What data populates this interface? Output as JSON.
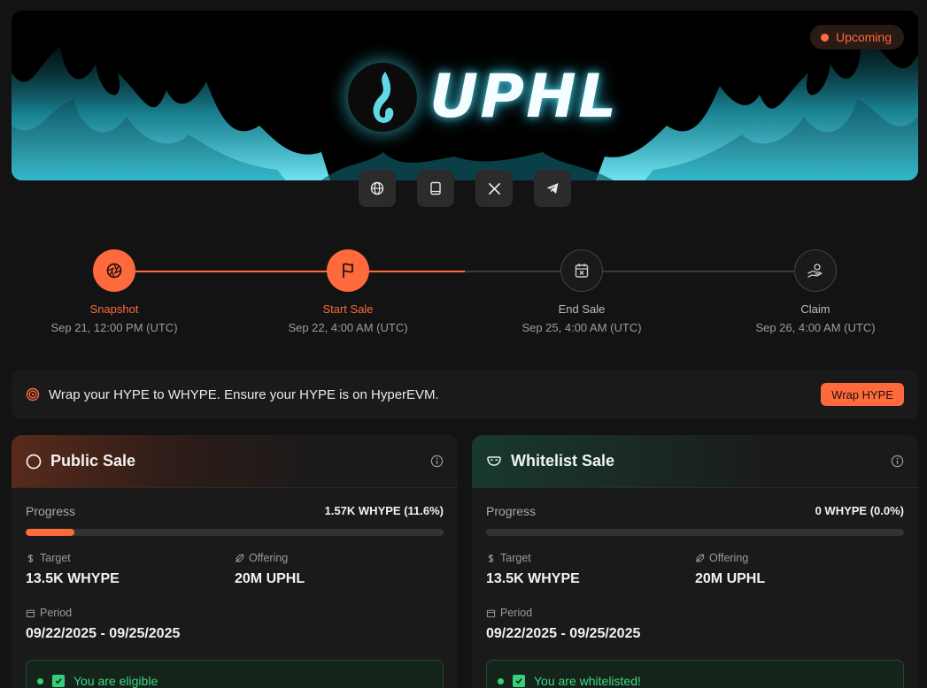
{
  "banner": {
    "status": "Upcoming",
    "project_name": "UPHL",
    "accent": "#ff6a3d",
    "glow": "#3cc8dc"
  },
  "socials": [
    {
      "name": "globe-icon"
    },
    {
      "name": "book-icon"
    },
    {
      "name": "x-logo-icon"
    },
    {
      "name": "telegram-icon"
    }
  ],
  "timeline": {
    "steps": [
      {
        "label": "Snapshot",
        "date": "Sep 21, 12:00 PM (UTC)",
        "icon": "aperture-icon",
        "state": "active"
      },
      {
        "label": "Start Sale",
        "date": "Sep 22, 4:00 AM (UTC)",
        "icon": "flag-icon",
        "state": "active"
      },
      {
        "label": "End Sale",
        "date": "Sep 25, 4:00 AM (UTC)",
        "icon": "calendar-x-icon",
        "state": "inactive"
      },
      {
        "label": "Claim",
        "date": "Sep 26, 4:00 AM (UTC)",
        "icon": "hand-coins-icon",
        "state": "inactive"
      }
    ]
  },
  "notice": {
    "text": "Wrap your HYPE to WHYPE. Ensure your HYPE is on HyperEVM.",
    "button": "Wrap HYPE"
  },
  "public_sale": {
    "title": "Public Sale",
    "progress_label": "Progress",
    "progress_value": "1.57K WHYPE (11.6%)",
    "progress_fraction": 0.116,
    "target_label": "Target",
    "target_value": "13.5K WHYPE",
    "offering_label": "Offering",
    "offering_value": "20M UPHL",
    "period_label": "Period",
    "period_value": "09/22/2025 - 09/25/2025",
    "eligibility": "You are eligible"
  },
  "whitelist_sale": {
    "title": "Whitelist Sale",
    "progress_label": "Progress",
    "progress_value": "0 WHYPE (0.0%)",
    "progress_fraction": 0.0,
    "target_label": "Target",
    "target_value": "13.5K WHYPE",
    "offering_label": "Offering",
    "offering_value": "20M UPHL",
    "period_label": "Period",
    "period_value": "09/22/2025 - 09/25/2025",
    "eligibility": "You are whitelisted!"
  }
}
